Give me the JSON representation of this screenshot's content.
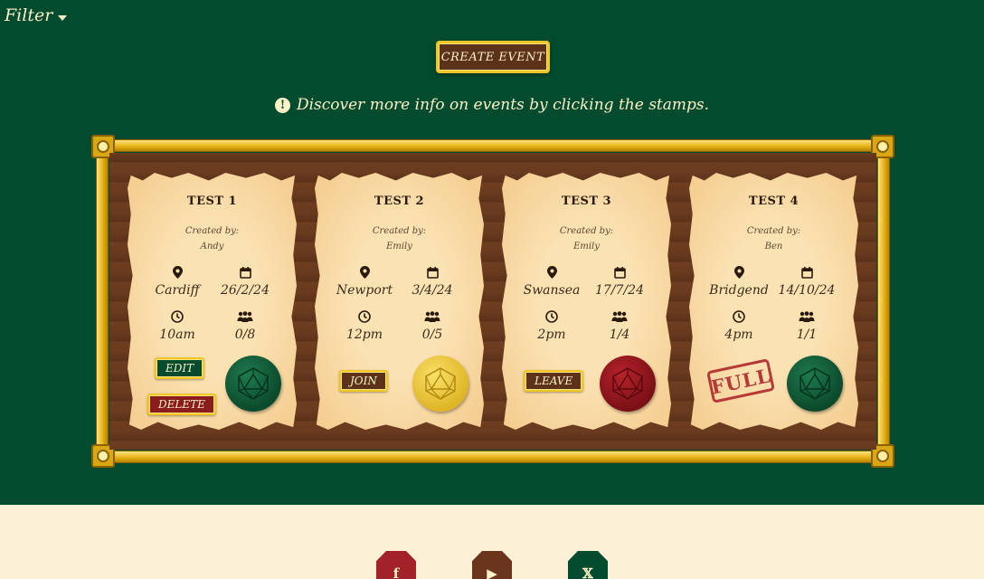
{
  "header": {
    "filter_label": "Filter",
    "create_event_label": "CREATE EVENT",
    "info_text": "Discover more info on events by clicking the stamps."
  },
  "events": [
    {
      "title": "TEST 1",
      "created_by_label": "Created by:",
      "creator": "Andy",
      "location": "Cardiff",
      "date": "26/2/24",
      "time": "10am",
      "attendees": "0/8",
      "seal_color": "green",
      "actions": [
        "EDIT",
        "DELETE"
      ]
    },
    {
      "title": "TEST 2",
      "created_by_label": "Created by:",
      "creator": "Emily",
      "location": "Newport",
      "date": "3/4/24",
      "time": "12pm",
      "attendees": "0/5",
      "seal_color": "yellow",
      "actions": [
        "JOIN"
      ]
    },
    {
      "title": "TEST 3",
      "created_by_label": "Created by:",
      "creator": "Emily",
      "location": "Swansea",
      "date": "17/7/24",
      "time": "2pm",
      "attendees": "1/4",
      "seal_color": "red",
      "actions": [
        "LEAVE"
      ]
    },
    {
      "title": "TEST 4",
      "created_by_label": "Created by:",
      "creator": "Ben",
      "location": "Bridgend",
      "date": "14/10/24",
      "time": "4pm",
      "attendees": "1/1",
      "seal_color": "green",
      "stamp": "FULL"
    }
  ],
  "footer": {
    "social": [
      {
        "name": "facebook",
        "glyph": "f",
        "color": "#a3222a"
      },
      {
        "name": "youtube",
        "glyph": "▶",
        "color": "#6b341c"
      },
      {
        "name": "x",
        "glyph": "𝕏",
        "color": "#024b2e"
      }
    ]
  },
  "colors": {
    "background": "#024b2e",
    "gold": "#f2c526",
    "parchment": "#fbe2b3",
    "wood": "#6a3a1e",
    "footer": "#fcf1d6"
  }
}
